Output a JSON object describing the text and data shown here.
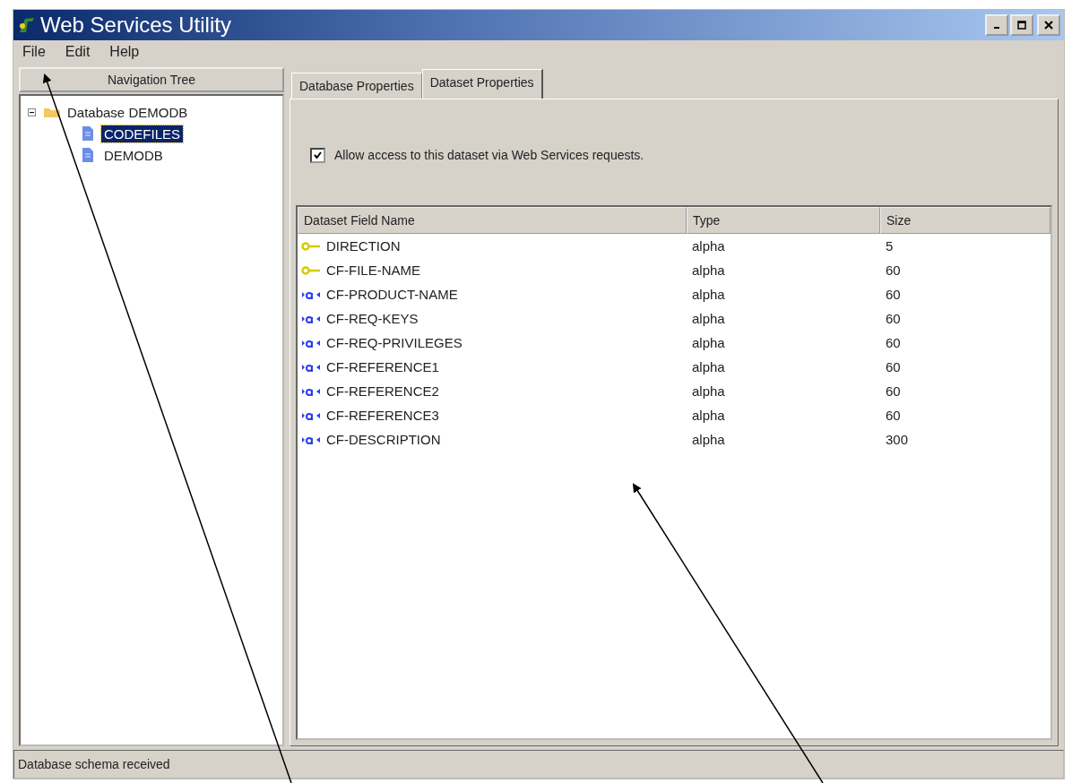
{
  "window": {
    "title": "Web Services Utility"
  },
  "menu": [
    "File",
    "Edit",
    "Help"
  ],
  "navigation": {
    "header": "Navigation Tree",
    "tree": [
      {
        "label": "Database DEMODB",
        "expanded": true,
        "selected": false,
        "children": [
          {
            "label": "CODEFILES",
            "selected": true
          },
          {
            "label": "DEMODB",
            "selected": false
          }
        ]
      }
    ]
  },
  "tabs": [
    {
      "label": "Database Properties",
      "selected": false
    },
    {
      "label": "Dataset Properties",
      "selected": true
    }
  ],
  "allow_access": {
    "label": "Allow access to this dataset via Web Services requests.",
    "checked": true
  },
  "table": {
    "columns": [
      "Dataset Field Name",
      "Type",
      "Size"
    ],
    "rows": [
      {
        "kind": "key",
        "name": "DIRECTION",
        "type": "alpha",
        "size": "5"
      },
      {
        "kind": "key",
        "name": "CF-FILE-NAME",
        "type": "alpha",
        "size": "60"
      },
      {
        "kind": "field",
        "name": "CF-PRODUCT-NAME",
        "type": "alpha",
        "size": "60"
      },
      {
        "kind": "field",
        "name": "CF-REQ-KEYS",
        "type": "alpha",
        "size": "60"
      },
      {
        "kind": "field",
        "name": "CF-REQ-PRIVILEGES",
        "type": "alpha",
        "size": "60"
      },
      {
        "kind": "field",
        "name": "CF-REFERENCE1",
        "type": "alpha",
        "size": "60"
      },
      {
        "kind": "field",
        "name": "CF-REFERENCE2",
        "type": "alpha",
        "size": "60"
      },
      {
        "kind": "field",
        "name": "CF-REFERENCE3",
        "type": "alpha",
        "size": "60"
      },
      {
        "kind": "field",
        "name": "CF-DESCRIPTION",
        "type": "alpha",
        "size": "300"
      }
    ]
  },
  "status_bar": "Database schema received"
}
